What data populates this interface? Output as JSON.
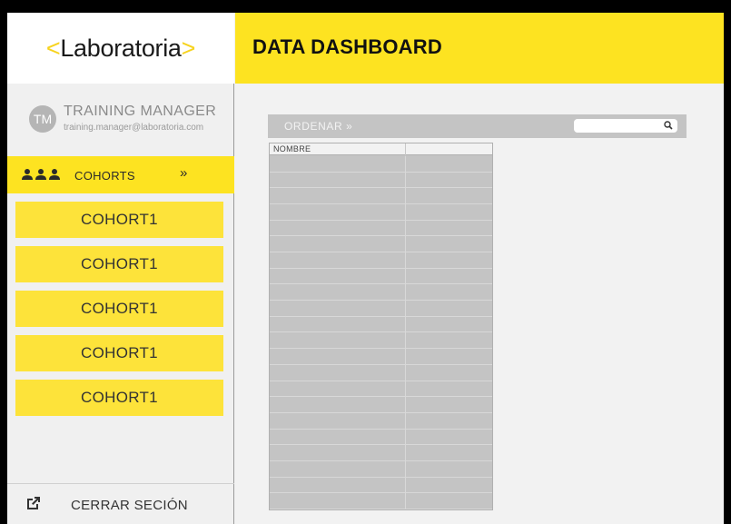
{
  "sidebar": {
    "logo": {
      "open": "<",
      "text": "Laboratoria",
      "close": ">"
    },
    "profile": {
      "initials": "TM",
      "name": "TRAINING MANAGER",
      "email": "training.manager@laboratoria.com"
    },
    "cohorts_label": "COHORTS",
    "cohorts_toggle_icon": "double-chevron-down",
    "cohort_items": [
      {
        "label": "COHORT1"
      },
      {
        "label": "COHORT1"
      },
      {
        "label": "COHORT1"
      },
      {
        "label": "COHORT1"
      },
      {
        "label": "COHORT1"
      }
    ],
    "logout_label": "CERRAR SECIÓN"
  },
  "header": {
    "title": "DATA DASHBOARD"
  },
  "toolbar": {
    "sort_label": "ORDENAR »",
    "search": {
      "value": "",
      "placeholder": ""
    }
  },
  "table": {
    "columns": [
      "NOMBRE",
      ""
    ],
    "rows": [
      [
        "",
        ""
      ],
      [
        "",
        ""
      ],
      [
        "",
        ""
      ],
      [
        "",
        ""
      ],
      [
        "",
        ""
      ],
      [
        "",
        ""
      ],
      [
        "",
        ""
      ],
      [
        "",
        ""
      ],
      [
        "",
        ""
      ],
      [
        "",
        ""
      ],
      [
        "",
        ""
      ],
      [
        "",
        ""
      ],
      [
        "",
        ""
      ],
      [
        "",
        ""
      ],
      [
        "",
        ""
      ],
      [
        "",
        ""
      ],
      [
        "",
        ""
      ],
      [
        "",
        ""
      ],
      [
        "",
        ""
      ],
      [
        "",
        ""
      ],
      [
        "",
        ""
      ],
      [
        "",
        ""
      ]
    ]
  },
  "colors": {
    "accent": "#fde321",
    "cohort": "#fde33a",
    "table_fill": "#c4c4c4",
    "sidebar_bg": "#f0f0f0"
  }
}
